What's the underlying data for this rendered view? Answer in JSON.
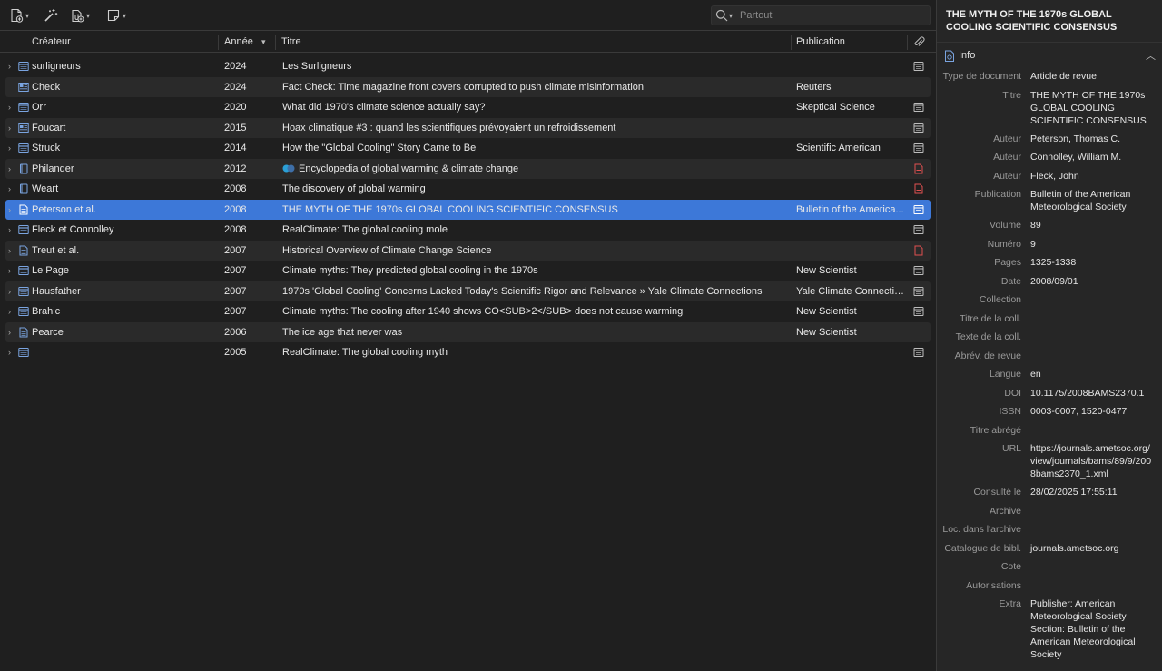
{
  "toolbar": {
    "search_placeholder": "Partout",
    "new_item_icon": "new-item-icon",
    "magic_wand_icon": "magic-wand-icon",
    "add_attachment_icon": "add-attachment-icon",
    "new_note_icon": "new-note-icon"
  },
  "columns": {
    "creator": "Créateur",
    "year": "Année",
    "title": "Titre",
    "publication": "Publication"
  },
  "colors": {
    "selected_row": "#3d78d8",
    "alt_row": "#2a2a2a",
    "pdf_icon": "#e05050",
    "item_icon": "#7aa4e0"
  },
  "rows": [
    {
      "creator": "surligneurs",
      "year": "2024",
      "title": "Les Surligneurs",
      "publication": "",
      "type": "webpage",
      "attachment": "snapshot"
    },
    {
      "creator": "Check",
      "year": "2024",
      "title": "Fact Check: Time magazine front covers corrupted to push climate misinformation",
      "publication": "Reuters",
      "type": "newspaper",
      "attachment": "",
      "noTwisty": true
    },
    {
      "creator": "Orr",
      "year": "2020",
      "title": "What did 1970's climate science actually say?",
      "publication": "Skeptical Science",
      "type": "webpage",
      "attachment": "snapshot"
    },
    {
      "creator": "Foucart",
      "year": "2015",
      "title": "Hoax climatique #3 : quand les scientifiques prévoyaient un refroidissement",
      "publication": "",
      "type": "newspaper",
      "attachment": "snapshot"
    },
    {
      "creator": "Struck",
      "year": "2014",
      "title": "How the \"Global Cooling\" Story Came to Be",
      "publication": "Scientific American",
      "type": "webpage",
      "attachment": "snapshot"
    },
    {
      "creator": "Philander",
      "year": "2012",
      "title": "Encyclopedia of global warming & climate change",
      "publication": "",
      "type": "book",
      "attachment": "pdf",
      "titleDots": true
    },
    {
      "creator": "Weart",
      "year": "2008",
      "title": "The discovery of global warming",
      "publication": "",
      "type": "book",
      "attachment": "pdf"
    },
    {
      "creator": "Peterson et al.",
      "year": "2008",
      "title": "THE MYTH OF THE 1970s GLOBAL COOLING SCIENTIFIC CONSENSUS",
      "publication": "Bulletin of the America...",
      "type": "journal",
      "attachment": "snapshot",
      "selected": true
    },
    {
      "creator": "Fleck et Connolley",
      "year": "2008",
      "title": "RealClimate: The global cooling mole",
      "publication": "",
      "type": "webpage",
      "attachment": "snapshot"
    },
    {
      "creator": "Treut et al.",
      "year": "2007",
      "title": "Historical Overview of Climate Change Science",
      "publication": "",
      "type": "journal",
      "attachment": "pdf"
    },
    {
      "creator": "Le Page",
      "year": "2007",
      "title": "Climate myths: They predicted global cooling in the 1970s",
      "publication": "New Scientist",
      "type": "webpage",
      "attachment": "snapshot"
    },
    {
      "creator": "Hausfather",
      "year": "2007",
      "title": "1970s 'Global Cooling' Concerns Lacked Today's Scientific Rigor and Relevance » Yale Climate Connections",
      "publication": "Yale Climate Connectio...",
      "type": "webpage",
      "attachment": "snapshot"
    },
    {
      "creator": "Brahic",
      "year": "2007",
      "title": "Climate myths: The cooling after 1940 shows CO<SUB>2</SUB> does not cause warming",
      "publication": "New Scientist",
      "type": "webpage",
      "attachment": "snapshot"
    },
    {
      "creator": "Pearce",
      "year": "2006",
      "title": "The ice age that never was",
      "publication": "New Scientist",
      "type": "journal",
      "attachment": ""
    },
    {
      "creator": "",
      "year": "2005",
      "title": "RealClimate: The global cooling myth",
      "publication": "",
      "type": "webpage",
      "attachment": "snapshot"
    }
  ],
  "detail": {
    "title": "THE MYTH OF THE 1970s GLOBAL COOLING SCIENTIFIC CONSENSUS",
    "section_label": "Info",
    "fields": [
      {
        "label": "Type de document",
        "value": "Article de revue"
      },
      {
        "label": "Titre",
        "value": "THE MYTH OF THE 1970s GLOBAL COOLING SCIENTIFIC CONSENSUS"
      },
      {
        "label": "Auteur",
        "value": "Peterson, Thomas C."
      },
      {
        "label": "Auteur",
        "value": "Connolley, William M."
      },
      {
        "label": "Auteur",
        "value": "Fleck, John"
      },
      {
        "label": "Publication",
        "value": "Bulletin of the American Meteorological Society"
      },
      {
        "label": "Volume",
        "value": "89"
      },
      {
        "label": "Numéro",
        "value": "9"
      },
      {
        "label": "Pages",
        "value": "1325-1338"
      },
      {
        "label": "Date",
        "value": "2008/09/01"
      },
      {
        "label": "Collection",
        "value": ""
      },
      {
        "label": "Titre de la coll.",
        "value": ""
      },
      {
        "label": "Texte de la coll.",
        "value": ""
      },
      {
        "label": "Abrév. de revue",
        "value": ""
      },
      {
        "label": "Langue",
        "value": "en"
      },
      {
        "label": "DOI",
        "value": "10.1175/2008BAMS2370.1"
      },
      {
        "label": "ISSN",
        "value": "0003-0007, 1520-0477"
      },
      {
        "label": "Titre abrégé",
        "value": ""
      },
      {
        "label": "URL",
        "value": "https://journals.ametsoc.org/view/journals/bams/89/9/2008bams2370_1.xml"
      },
      {
        "label": "Consulté le",
        "value": "28/02/2025 17:55:11"
      },
      {
        "label": "Archive",
        "value": ""
      },
      {
        "label": "Loc. dans l'archive",
        "value": ""
      },
      {
        "label": "Catalogue de bibl.",
        "value": "journals.ametsoc.org"
      },
      {
        "label": "Cote",
        "value": ""
      },
      {
        "label": "Autorisations",
        "value": ""
      },
      {
        "label": "Extra",
        "value": "Publisher: American Meteorological Society Section: Bulletin of the American Meteorological Society"
      }
    ]
  }
}
